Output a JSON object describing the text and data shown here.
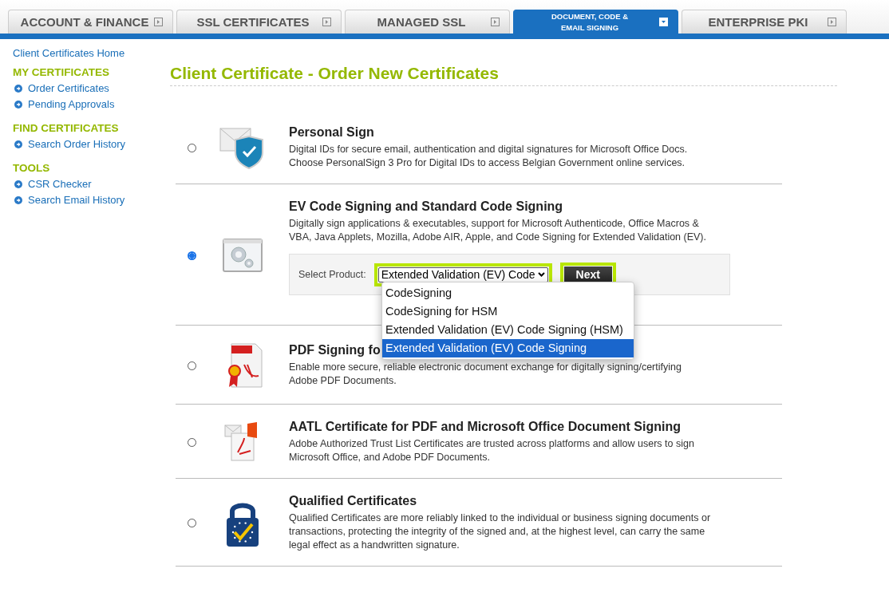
{
  "tabs": [
    {
      "label": "ACCOUNT & FINANCE",
      "selected": false
    },
    {
      "label": "SSL CERTIFICATES",
      "selected": false
    },
    {
      "label": "MANAGED SSL",
      "selected": false
    },
    {
      "label": "DOCUMENT, CODE & EMAIL SIGNING",
      "selected": true
    },
    {
      "label": "ENTERPRISE PKI",
      "selected": false
    }
  ],
  "sidebar": {
    "home": "Client Certificates Home",
    "sections": [
      {
        "heading": "MY CERTIFICATES",
        "items": [
          "Order Certificates",
          "Pending Approvals"
        ]
      },
      {
        "heading": "FIND CERTIFICATES",
        "items": [
          "Search Order History"
        ]
      },
      {
        "heading": "TOOLS",
        "items": [
          "CSR Checker",
          "Search Email History"
        ]
      }
    ]
  },
  "page_title": "Client Certificate - Order New Certificates",
  "products": [
    {
      "kind": "email",
      "name": "Personal Sign",
      "description": "Digital IDs for secure email, authentication and digital signatures for Microsoft Office Docs. Choose PersonalSign 3 Pro for Digital IDs to access Belgian Government online services.",
      "selected": false
    },
    {
      "kind": "code",
      "name": "EV Code Signing and Standard Code Signing",
      "description": "Digitally sign applications & executables, support for Microsoft Authenticode, Office Macros & VBA, Java Applets, Mozilla, Adobe AIR, Apple, and Code Signing for Extended Validation (EV).",
      "selected": true,
      "form": {
        "label": "Select Product:",
        "value": "Extended Validation (EV) Code",
        "button": "Next",
        "options": [
          {
            "label": "CodeSigning",
            "selected": false
          },
          {
            "label": "CodeSigning for HSM",
            "selected": false
          },
          {
            "label": "Extended Validation (EV) Code Signing (HSM)",
            "selected": false
          },
          {
            "label": "Extended Validation (EV) Code Signing",
            "selected": true
          }
        ]
      }
    },
    {
      "kind": "pdf",
      "name": "PDF Signing fo",
      "description": "Enable more secure, reliable electronic document exchange for digitally signing/certifying Adobe PDF Documents.",
      "selected": false
    },
    {
      "kind": "aatl",
      "name": "AATL Certificate for PDF and Microsoft Office Document Signing",
      "description": "Adobe Authorized Trust List Certificates are trusted across platforms and allow users to sign Microsoft Office, and Adobe PDF Documents.",
      "selected": false
    },
    {
      "kind": "lock",
      "name": "Qualified Certificates",
      "description": "Qualified Certificates are more reliably linked to the individual or business signing documents or transactions, protecting the integrity of the signed and, at the highest level, can carry the same legal effect as a handwritten signature.",
      "selected": false
    }
  ]
}
